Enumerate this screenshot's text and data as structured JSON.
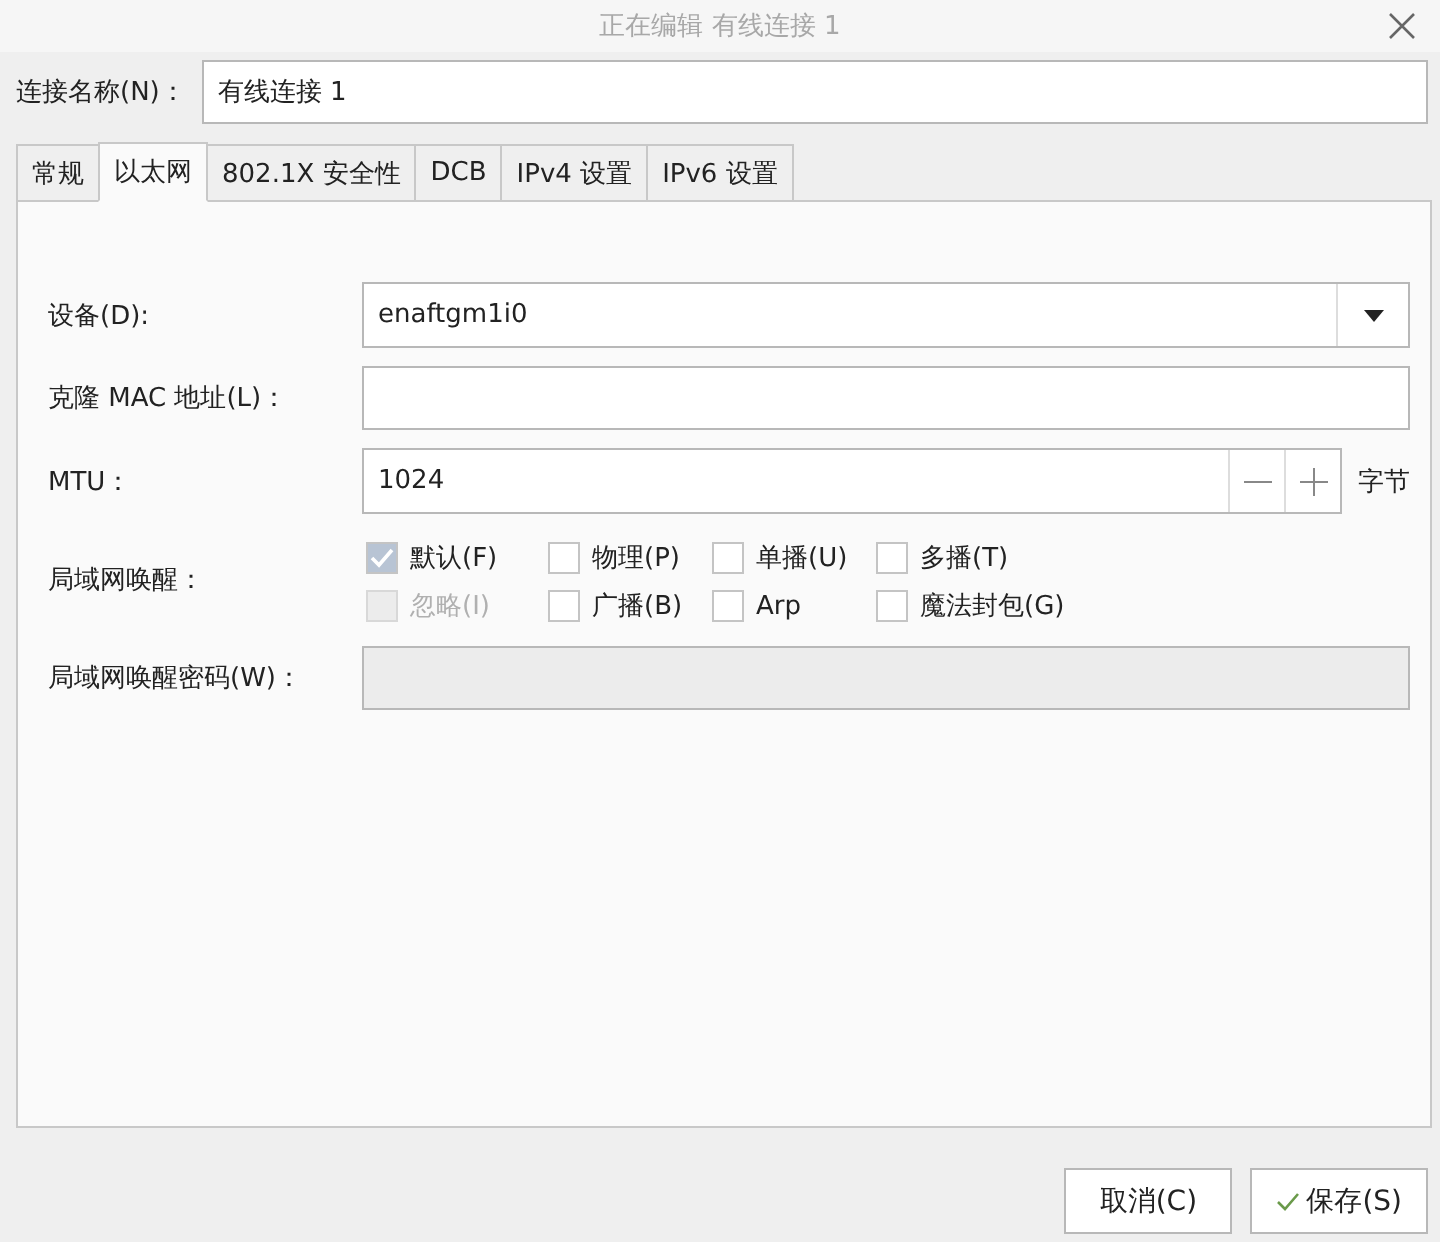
{
  "window": {
    "title": "正在编辑 有线连接 1"
  },
  "connection_name": {
    "label": "连接名称(N)：",
    "value": "有线连接 1"
  },
  "tabs": [
    {
      "label": "常规",
      "selected": false
    },
    {
      "label": "以太网",
      "selected": true
    },
    {
      "label": "802.1X 安全性",
      "selected": false
    },
    {
      "label": "DCB",
      "selected": false
    },
    {
      "label": "IPv4 设置",
      "selected": false
    },
    {
      "label": "IPv6 设置",
      "selected": false
    }
  ],
  "device": {
    "label": "设备(D):",
    "value": "enaftgm1i0"
  },
  "clone_mac": {
    "label": "克隆 MAC 地址(L)："
  },
  "mtu": {
    "label": "MTU：",
    "value": "1024",
    "unit": "字节"
  },
  "wake_on_lan": {
    "label": "局域网唤醒：",
    "options": [
      {
        "label": "默认(F)",
        "checked": true,
        "disabled": false
      },
      {
        "label": "物理(P)",
        "checked": false,
        "disabled": false
      },
      {
        "label": "单播(U)",
        "checked": false,
        "disabled": false
      },
      {
        "label": "多播(T)",
        "checked": false,
        "disabled": false
      },
      {
        "label": "忽略(I)",
        "checked": false,
        "disabled": true
      },
      {
        "label": "广播(B)",
        "checked": false,
        "disabled": false
      },
      {
        "label": "Arp",
        "checked": false,
        "disabled": false
      },
      {
        "label": "魔法封包(G)",
        "checked": false,
        "disabled": false
      }
    ]
  },
  "wol_password": {
    "label": "局域网唤醒密码(W)：",
    "disabled": true
  },
  "buttons": [
    {
      "label": "取消(C)",
      "kind": "plain"
    },
    {
      "label": "保存(S)",
      "kind": "confirm"
    }
  ]
}
